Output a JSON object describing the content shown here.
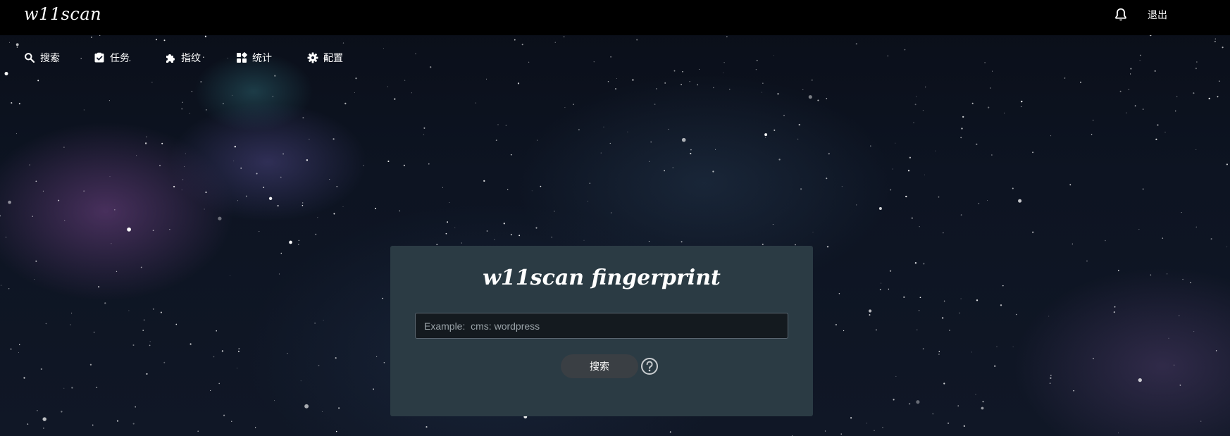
{
  "header": {
    "logo": "w11scan",
    "logout_label": "退出"
  },
  "nav": {
    "items": [
      {
        "label": "搜索",
        "icon": "search-icon"
      },
      {
        "label": "任务",
        "icon": "task-icon"
      },
      {
        "label": "指纹",
        "icon": "puzzle-icon"
      },
      {
        "label": "统计",
        "icon": "stats-icon"
      },
      {
        "label": "配置",
        "icon": "gear-icon"
      }
    ]
  },
  "search_card": {
    "title": "w11scan fingerprint",
    "placeholder": "Example:  cms: wordpress",
    "button_label": "搜索"
  },
  "colors": {
    "topbar": "#000000",
    "card": "#2b3b44",
    "button": "#3a3f44"
  }
}
